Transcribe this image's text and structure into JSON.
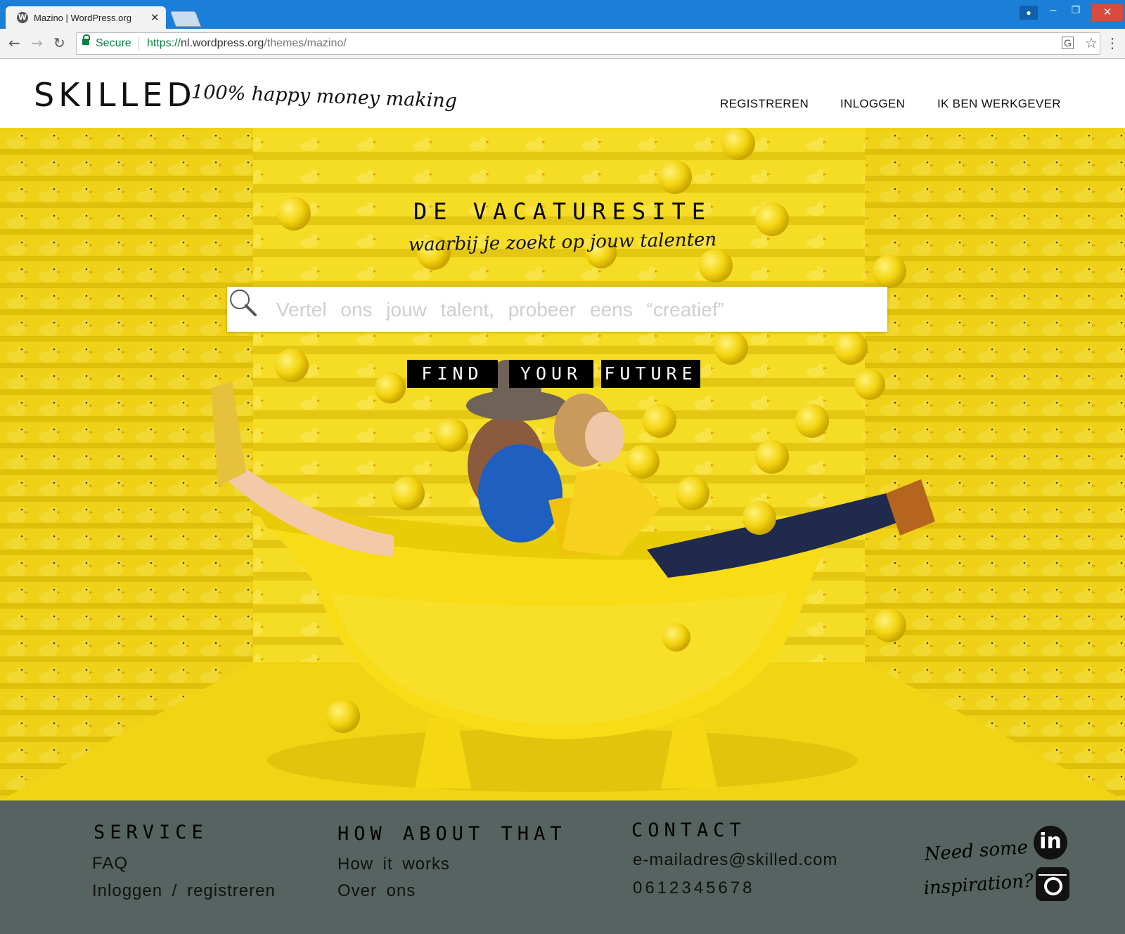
{
  "browser": {
    "tab_title": "Mazino | WordPress.org",
    "tab_close": "✕",
    "security_label": "Secure",
    "url_scheme": "https://",
    "url_host": "nl.wordpress.org",
    "url_path": "/themes/mazino/"
  },
  "site": {
    "logo": "SKILLED",
    "tagline": "100% happy money making",
    "nav": [
      "REGISTREREN",
      "INLOGGEN",
      "IK BEN WERKGEVER"
    ]
  },
  "hero": {
    "title": "DE VACATURESITE",
    "subtitle": "waarbij je zoekt op jouw talenten",
    "search_placeholder": "Vertel ons jouw talent, probeer eens “creatief”",
    "cta_words": [
      "FIND",
      "YOUR",
      "FUTURE"
    ]
  },
  "footer": {
    "service": {
      "heading": "SERVICE",
      "links": [
        "FAQ",
        "Inloggen / registreren"
      ]
    },
    "about": {
      "heading": "HOW ABOUT THAT",
      "links": [
        "How it works",
        "Over ons"
      ]
    },
    "contact": {
      "heading": "CONTACT",
      "email": "e-mailadres@skilled.com",
      "phone": "0612345678"
    },
    "inspiration": [
      "Need some",
      "inspiration?"
    ],
    "linkedin_glyph": "in"
  },
  "colors": {
    "browser_blue": "#1b7fd8",
    "hero_yellow": "#f2d51b",
    "footer_gray": "#566360"
  }
}
